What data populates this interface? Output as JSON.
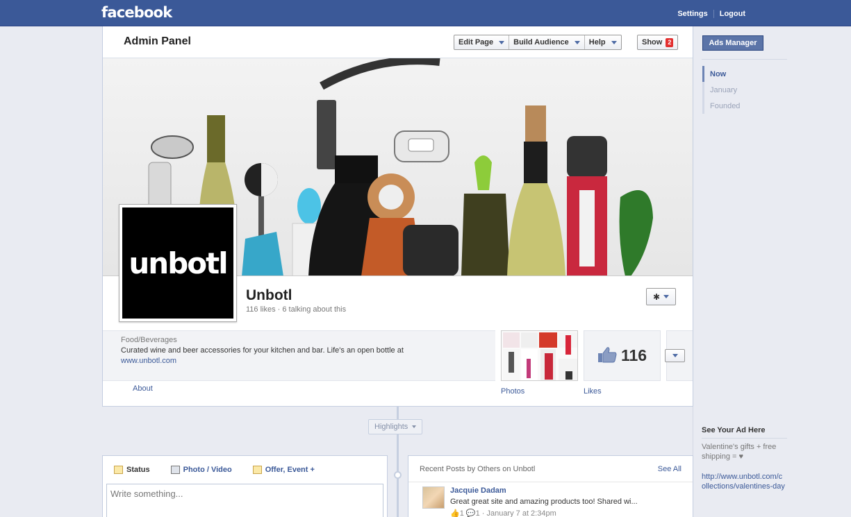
{
  "topbar": {
    "logo": "facebook",
    "settings": "Settings",
    "logout": "Logout"
  },
  "admin": {
    "title": "Admin Panel",
    "edit_page": "Edit Page",
    "build_audience": "Build Audience",
    "help": "Help",
    "show": "Show",
    "show_count": "2"
  },
  "page": {
    "avatar_text": "unbotl",
    "name": "Unbotl",
    "stats": "116 likes · 6 talking about this",
    "category": "Food/Beverages",
    "description": "Curated wine and beer accessories for your kitchen and bar. Life's an open bottle at",
    "website": "www.unbotl.com",
    "about_label": "About",
    "photos_label": "Photos",
    "likes_label": "Likes",
    "likes_count": "116"
  },
  "timeline": {
    "highlights": "Highlights"
  },
  "composer": {
    "tab_status": "Status",
    "tab_photo": "Photo / Video",
    "tab_offer": "Offer, Event +",
    "placeholder": "Write something..."
  },
  "recent": {
    "title": "Recent Posts by Others on Unbotl",
    "see_all": "See All",
    "post": {
      "author": "Jacquie Dadam",
      "text": "Great great site and amazing products too! Shared wi...",
      "meta": "👍1 💬1 · January 7 at 2:34pm"
    }
  },
  "sidebar": {
    "ads_manager": "Ads Manager",
    "nav": [
      "Now",
      "January",
      "Founded"
    ],
    "ad_title": "See Your Ad Here",
    "ad_text": "Valentine's gifts + free shipping = ♥",
    "ad_link": "http://www.unbotl.com/collections/valentines-day"
  },
  "colors": {
    "brand": "#3b5998",
    "badge": "#e32f2f"
  }
}
